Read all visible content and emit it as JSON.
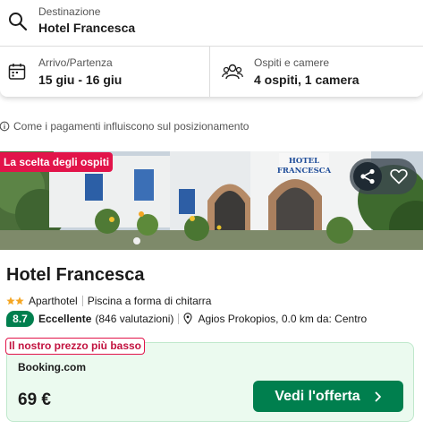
{
  "search": {
    "destination_label": "Destinazione",
    "destination_value": "Hotel Francesca",
    "dates_label": "Arrivo/Partenza",
    "dates_value": "15 giu - 16 giu",
    "guests_label": "Ospiti e camere",
    "guests_value": "4 ospiti, 1 camera",
    "icons": {
      "destination": "search-icon",
      "dates": "calendar-icon",
      "guests": "guests-icon"
    }
  },
  "payment_note": {
    "text": "Come i pagamenti influiscono sul posizionamento",
    "icon": "info-icon"
  },
  "hotel": {
    "guest_choice_badge": "La scelta degli ospiti",
    "image_sign": "HOTEL\nFRANCESCA",
    "name": "Hotel Francesca",
    "star_rating": 2,
    "type": "Aparthotel",
    "feature": "Piscina a forma di chitarra",
    "rating_score": "8.7",
    "rating_word": "Eccellente",
    "review_count": "(846 valutazioni)",
    "location": "Agios Prokopios, 0.0 km da: Centro",
    "actions": {
      "share": "share-icon",
      "favorite": "heart-icon"
    }
  },
  "deal": {
    "badge": "Il nostro prezzo più basso",
    "provider": "Booking.com",
    "price": "69 €",
    "button_label": "Vedi l'offerta"
  },
  "colors": {
    "brand_pink": "#e2144a",
    "rating_green": "#007f4e",
    "deal_background": "#ebfaef",
    "star_gold": "#f5a623"
  }
}
